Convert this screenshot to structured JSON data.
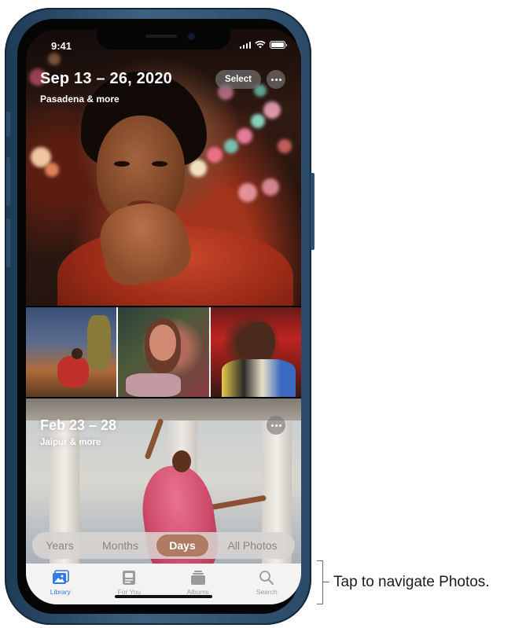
{
  "status_bar": {
    "time": "9:41",
    "icons": [
      "signal-icon",
      "wifi-icon",
      "battery-icon"
    ]
  },
  "hero": {
    "title": "Sep 13 – 26, 2020",
    "subtitle": "Pasadena & more",
    "select_label": "Select",
    "more_icon": "ellipsis-icon"
  },
  "memory2": {
    "title": "Feb 23 – 28",
    "subtitle": "Jaipur & more",
    "more_icon": "ellipsis-icon"
  },
  "segmented": {
    "options": [
      "Years",
      "Months",
      "Days",
      "All Photos"
    ],
    "selected": "Days",
    "selected_color": "#b07a63"
  },
  "tabbar": {
    "active_color": "#2f7ae5",
    "inactive_color": "#9a9a9a",
    "tabs": [
      {
        "label": "Library",
        "icon": "library-icon",
        "active": true
      },
      {
        "label": "For You",
        "icon": "for-you-icon",
        "active": false
      },
      {
        "label": "Albums",
        "icon": "albums-icon",
        "active": false
      },
      {
        "label": "Search",
        "icon": "search-icon",
        "active": false
      }
    ]
  },
  "callout": {
    "text": "Tap to navigate Photos."
  }
}
